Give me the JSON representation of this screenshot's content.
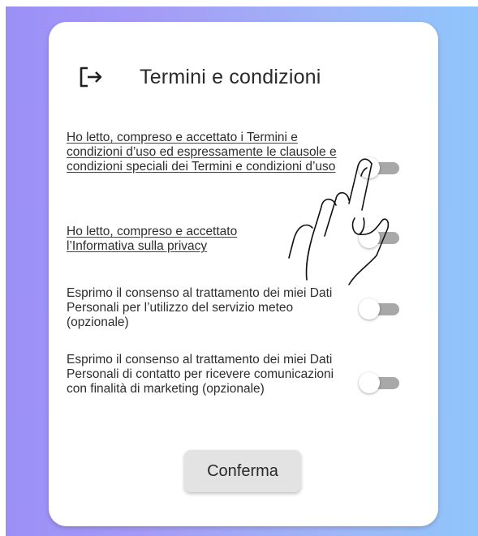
{
  "header": {
    "icon": "logout-icon",
    "title": "Termini e condizioni"
  },
  "consents": [
    {
      "text": "Ho letto, compreso e accettato i Termini e condizioni d’uso ed espressamente le clausole e condizioni speciali dei Termini e condizioni d’uso",
      "is_link": true,
      "enabled": false
    },
    {
      "text": "Ho letto, compreso e accettato l’Informativa sulla privacy",
      "is_link": true,
      "enabled": false
    },
    {
      "text": "Esprimo il consenso al trattamento dei miei Dati Personali per l’utilizzo del servizio meteo (opzionale)",
      "is_link": false,
      "enabled": false
    },
    {
      "text": "Esprimo il consenso al trattamento dei miei Dati Personali di contatto per ricevere comunicazioni con finalità di marketing (opzionale)",
      "is_link": false,
      "enabled": false
    }
  ],
  "confirm_button": {
    "label": "Conferma"
  },
  "overlay": {
    "icon": "pointing-hand-icon"
  },
  "colors": {
    "background_gradient_start": "#9b8ff7",
    "background_gradient_end": "#8fc5fb",
    "card": "#ffffff",
    "toggle_track": "#a8a8a8",
    "button": "#e3e3e3"
  }
}
